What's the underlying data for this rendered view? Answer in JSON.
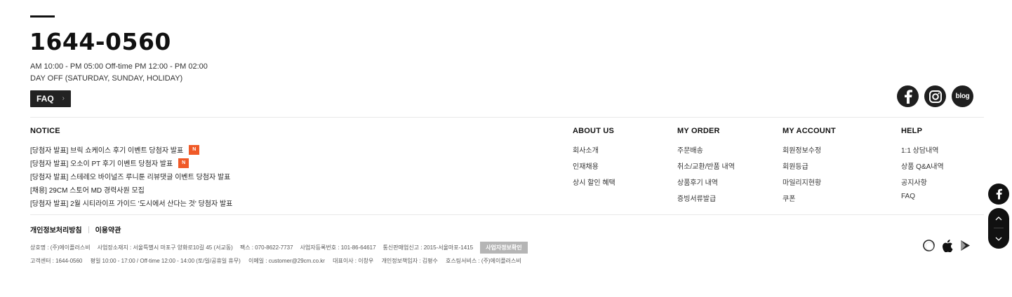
{
  "cs": {
    "phone": "1644-0560",
    "hours": "AM 10:00 - PM 05:00  Off-time PM 12:00 - PM 02:00",
    "dayoff": "DAY OFF (SATURDAY, SUNDAY, HOLIDAY)",
    "faq_label": "FAQ"
  },
  "social": {
    "facebook_icon": "facebook-icon",
    "instagram_icon": "instagram-icon",
    "blog_label": "blog"
  },
  "notice": {
    "title": "NOTICE",
    "items": [
      {
        "text": "[당첨자 발표] 브릭 쇼케이스 후기 이벤트 당첨자 발표",
        "badge": "N"
      },
      {
        "text": "[당첨자 발표] 오소이 PT 후기 이벤트 당첨자 발표",
        "badge": "N"
      },
      {
        "text": "[당첨자 발표] 스테레오 바이널즈 루니툰 리뷰댓글 이벤트 당첨자 발표"
      },
      {
        "text": "[채용] 29CM 스토어 MD 경력사원 모집"
      },
      {
        "text": "[당첨자 발표] 2월 시티라이프 가이드 '도시에서 산다는 것' 당첨자 발표"
      }
    ]
  },
  "menus": {
    "about": {
      "title": "ABOUT US",
      "links": [
        "회사소개",
        "인재채용",
        "상시 할인 혜택"
      ]
    },
    "order": {
      "title": "MY ORDER",
      "links": [
        "주문배송",
        "취소/교환/반품 내역",
        "상품후기 내역",
        "증빙서류발급"
      ]
    },
    "account": {
      "title": "MY ACCOUNT",
      "links": [
        "회원정보수정",
        "회원등급",
        "마일리지현황",
        "쿠폰"
      ]
    },
    "help": {
      "title": "HELP",
      "links": [
        "1:1 상담내역",
        "상품 Q&A내역",
        "공지사항",
        "FAQ"
      ]
    }
  },
  "policy": {
    "privacy": "개인정보처리방침",
    "terms": "이용약관"
  },
  "company": {
    "name": "상호명 : (주)에이플러스비",
    "address": "사업장소재지 : 서울특별시 마포구 양화로10길 45 (서교동)",
    "fax": "팩스 : 070-8622-7737",
    "bizno": "사업자등록번호 : 101-86-64617",
    "ecommerce": "통신판매업신고 : 2015-서울마포-1415",
    "biz_check": "사업자정보확인",
    "center": "고객센터 : 1644-0560",
    "weekday": "평일 10:00 - 17:00 / Off-time 12:00 - 14:00 (토/일/공휴일 휴무)",
    "email": "이메일 : customer@29cm.co.kr",
    "ceo": "대표이사 : 이창우",
    "privacy_officer": "개인정보책임자 : 김평수",
    "hosting": "호스팅서비스 : (주)에이플러스비"
  },
  "apps": [
    "app-circle-icon",
    "apple-icon",
    "google-play-icon"
  ],
  "float": {
    "facebook_icon": "facebook-icon",
    "up_icon": "chevron-up-icon",
    "down_icon": "chevron-down-icon"
  },
  "colors": {
    "accent_badge": "#f05a28",
    "dark": "#1f1f1f",
    "biz_button": "#b5b5b5"
  }
}
